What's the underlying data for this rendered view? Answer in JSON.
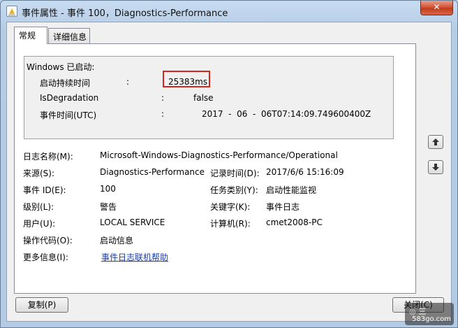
{
  "window": {
    "title": "事件属性 - 事件 100，Diagnostics-Performance",
    "close_label": "✕"
  },
  "tabs": [
    {
      "label": "常规",
      "active": true
    },
    {
      "label": "详细信息",
      "active": false
    }
  ],
  "description": {
    "heading": "Windows 已启动:",
    "rows": [
      {
        "key": "启动持续时间",
        "sep": ":",
        "value": "25383ms",
        "highlighted": true
      },
      {
        "key": "IsDegradation",
        "sep": ":",
        "value": "false"
      },
      {
        "key": "事件时间(UTC)",
        "sep": ":",
        "value": "2017  -  06  -  06T07:14:09.749600400Z"
      }
    ]
  },
  "fields": {
    "log_name": {
      "label": "日志名称(M):",
      "value": "Microsoft-Windows-Diagnostics-Performance/Operational"
    },
    "source": {
      "label": "来源(S):",
      "value": "Diagnostics-Performance"
    },
    "logged": {
      "label": "记录时间(D):",
      "value": "2017/6/6 15:16:09"
    },
    "event_id": {
      "label": "事件 ID(E):",
      "value": "100"
    },
    "task_category": {
      "label": "任务类别(Y):",
      "value": "启动性能监视"
    },
    "level": {
      "label": "级别(L):",
      "value": "警告"
    },
    "keywords": {
      "label": "关键字(K):",
      "value": "事件日志"
    },
    "user": {
      "label": "用户(U):",
      "value": "LOCAL SERVICE"
    },
    "computer": {
      "label": "计算机(R):",
      "value": "cmet2008-PC"
    },
    "opcode": {
      "label": "操作代码(O):",
      "value": "启动信息"
    },
    "more_info": {
      "label": "更多信息(I):",
      "link": "事件日志联机帮助"
    }
  },
  "buttons": {
    "copy": "复制(P)",
    "close": "关闭(C)"
  },
  "watermark": {
    "text": "583go.com"
  },
  "colors": {
    "highlight": "#d9231d",
    "link": "#1a3ea8"
  },
  "icons": [
    "event-warning-icon",
    "close-icon",
    "up-arrow-icon",
    "down-arrow-icon"
  ]
}
